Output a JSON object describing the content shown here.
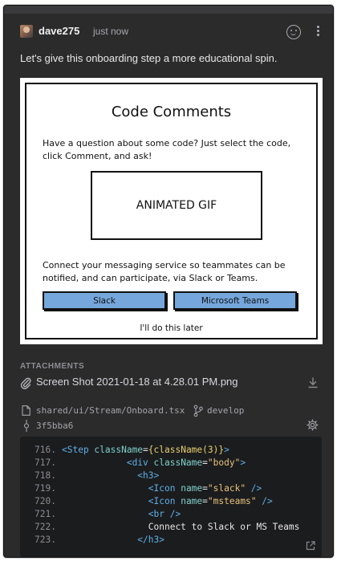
{
  "comment": {
    "author": "dave275",
    "timestamp": "just now",
    "message": "Let's give this onboarding step a more educational spin."
  },
  "mockup": {
    "title": "Code Comments",
    "intro": "Have a question about some code? Just select the code, click Comment, and ask!",
    "gif_placeholder": "ANIMATED GIF",
    "connect_text": "Connect your messaging service so teammates can be notified, and can participate, via Slack or Teams.",
    "slack_button": "Slack",
    "teams_button": "Microsoft Teams",
    "later_link": "I'll do this later",
    "button_color": "#75a7dc"
  },
  "attachments": {
    "label": "ATTACHMENTS",
    "items": [
      {
        "name": "Screen Shot 2021-01-18 at 4.28.01 PM.png",
        "icon": "paperclip-icon"
      }
    ]
  },
  "code_ref": {
    "file_path": "shared/ui/Stream/Onboard.tsx",
    "branch": "develop",
    "commit": "3f5bba6"
  },
  "code": {
    "lines": [
      {
        "num": "716.",
        "parts": [
          [
            "tag",
            "<Step "
          ],
          [
            "attr",
            "className"
          ],
          [
            "plain",
            "="
          ],
          [
            "brace",
            "{className(3)}"
          ],
          [
            "tag",
            ">"
          ]
        ]
      },
      {
        "num": "717.",
        "parts": [
          [
            "plain",
            "            "
          ],
          [
            "tag",
            "<div "
          ],
          [
            "attr",
            "className"
          ],
          [
            "plain",
            "="
          ],
          [
            "str",
            "\"body\""
          ],
          [
            "tag",
            ">"
          ]
        ]
      },
      {
        "num": "718.",
        "parts": [
          [
            "plain",
            "              "
          ],
          [
            "tag",
            "<h3>"
          ]
        ]
      },
      {
        "num": "719.",
        "parts": [
          [
            "plain",
            "                "
          ],
          [
            "tag",
            "<Icon "
          ],
          [
            "attr",
            "name"
          ],
          [
            "plain",
            "="
          ],
          [
            "str",
            "\"slack\""
          ],
          [
            "tag",
            " />"
          ]
        ]
      },
      {
        "num": "720.",
        "parts": [
          [
            "plain",
            "                "
          ],
          [
            "tag",
            "<Icon "
          ],
          [
            "attr",
            "name"
          ],
          [
            "plain",
            "="
          ],
          [
            "str",
            "\"msteams\""
          ],
          [
            "tag",
            " />"
          ]
        ]
      },
      {
        "num": "721.",
        "parts": [
          [
            "plain",
            "                "
          ],
          [
            "tag",
            "<br />"
          ]
        ]
      },
      {
        "num": "722.",
        "parts": [
          [
            "plain",
            "                Connect to Slack or MS Teams"
          ]
        ]
      },
      {
        "num": "723.",
        "parts": [
          [
            "plain",
            "              "
          ],
          [
            "tag",
            "</h3>"
          ]
        ]
      }
    ]
  },
  "colors": {
    "panel_bg": "#2b2b2c",
    "code_bg": "#1b1c1e",
    "tag": "#5fb0e8",
    "attr": "#7fd1c9",
    "string": "#e8c27a"
  }
}
